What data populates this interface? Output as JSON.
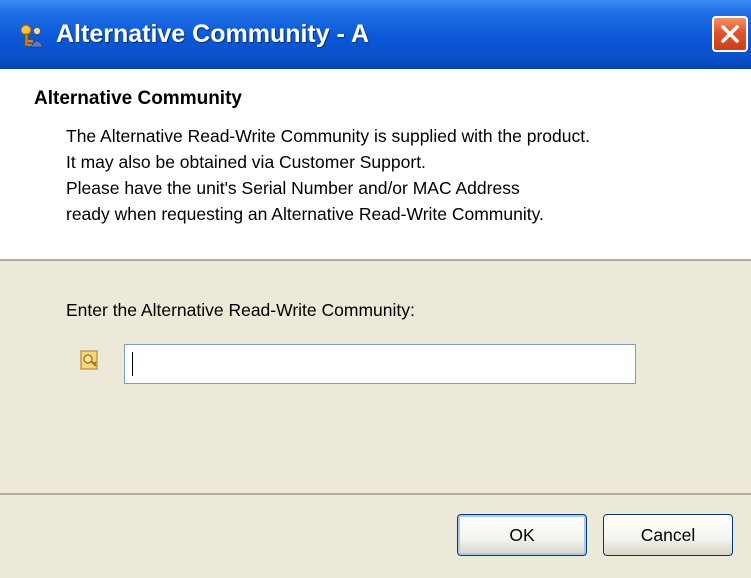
{
  "window": {
    "title": "Alternative Community - A",
    "icon": "key-person-icon",
    "close_icon": "close-icon",
    "close_color": "#e0552a",
    "title_color": "#0a58d6"
  },
  "header": {
    "heading": "Alternative Community",
    "description_lines": [
      "The Alternative Read-Write Community is supplied with the product.",
      "It may also be obtained via Customer Support.",
      "Please have the unit's Serial Number and/or MAC Address",
      "ready when requesting an Alternative Read-Write Community."
    ]
  },
  "form": {
    "prompt_label": "Enter the Alternative Read-Write Community:",
    "field_icon": "key-icon",
    "community_value": ""
  },
  "buttons": {
    "ok_label": "OK",
    "cancel_label": "Cancel"
  }
}
